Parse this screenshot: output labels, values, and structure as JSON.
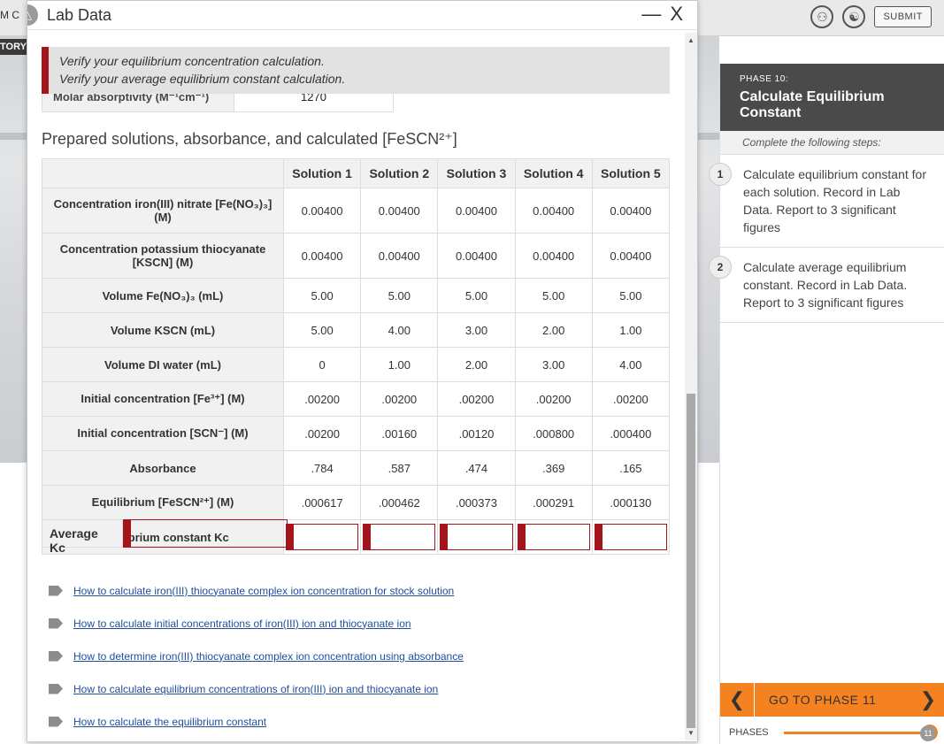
{
  "background": {
    "left_title": "M C",
    "story_label": "TORY",
    "submit_label": "SUBMIT",
    "accessibility_icon": "accessibility-icon",
    "globe_icon": "globe-icon"
  },
  "window": {
    "title": "Lab Data",
    "close_label": "— X"
  },
  "alert": {
    "line1": "Verify your equilibrium concentration calculation.",
    "line2": "Verify your average equilibrium constant calculation."
  },
  "molar": {
    "label": "Molar absorptivity (M⁻¹cm⁻¹)",
    "value": "1270"
  },
  "section_title": "Prepared solutions, absorbance, and calculated [FeSCN²⁺]",
  "table": {
    "headers": [
      "Solution 1",
      "Solution 2",
      "Solution 3",
      "Solution 4",
      "Solution 5"
    ],
    "rows": [
      {
        "label": "Concentration iron(III) nitrate [Fe(NO₃)₃] (M)",
        "values": [
          "0.00400",
          "0.00400",
          "0.00400",
          "0.00400",
          "0.00400"
        ]
      },
      {
        "label": "Concentration potassium thiocyanate [KSCN] (M)",
        "values": [
          "0.00400",
          "0.00400",
          "0.00400",
          "0.00400",
          "0.00400"
        ]
      },
      {
        "label": "Volume Fe(NO₃)₃ (mL)",
        "values": [
          "5.00",
          "5.00",
          "5.00",
          "5.00",
          "5.00"
        ]
      },
      {
        "label": "Volume KSCN (mL)",
        "values": [
          "5.00",
          "4.00",
          "3.00",
          "2.00",
          "1.00"
        ]
      },
      {
        "label": "Volume DI water (mL)",
        "values": [
          "0",
          "1.00",
          "2.00",
          "3.00",
          "4.00"
        ]
      },
      {
        "label": "Initial concentration [Fe³⁺] (M)",
        "values": [
          ".00200",
          ".00200",
          ".00200",
          ".00200",
          ".00200"
        ]
      },
      {
        "label": "Initial concentration [SCN⁻] (M)",
        "values": [
          ".00200",
          ".00160",
          ".00120",
          ".000800",
          ".000400"
        ]
      },
      {
        "label": "Absorbance",
        "values": [
          ".784",
          ".587",
          ".474",
          ".369",
          ".165"
        ]
      },
      {
        "label": "Equilibrium [FeSCN²⁺] (M)",
        "values": [
          ".000617",
          ".000462",
          ".000373",
          ".000291",
          ".000130"
        ]
      }
    ],
    "kc_label": "Equilibrium constant Kc"
  },
  "average": {
    "label": "Average Kc"
  },
  "links": [
    "How to calculate iron(III) thiocyanate complex ion concentration for stock solution",
    "How to calculate initial concentrations of iron(III) ion and thiocyanate ion",
    "How to determine iron(III) thiocyanate complex ion concentration using absorbance",
    "How to calculate equilibrium concentrations of iron(III) ion and thiocyanate ion",
    "How to calculate the equilibrium constant"
  ],
  "panel": {
    "phase_number": "PHASE 10:",
    "phase_title": "Calculate Equilibrium Constant",
    "subtitle": "Complete the following steps:",
    "steps": [
      {
        "num": "1",
        "text": "Calculate equilibrium constant for each solution. Record in Lab Data. Report to 3 significant figures"
      },
      {
        "num": "2",
        "text": "Calculate average equilibrium constant. Record in Lab Data. Report to 3 significant figures"
      }
    ],
    "go_label": "GO TO PHASE 11",
    "phases_label": "PHASES",
    "phase_current": "10",
    "phase_total": "11"
  }
}
